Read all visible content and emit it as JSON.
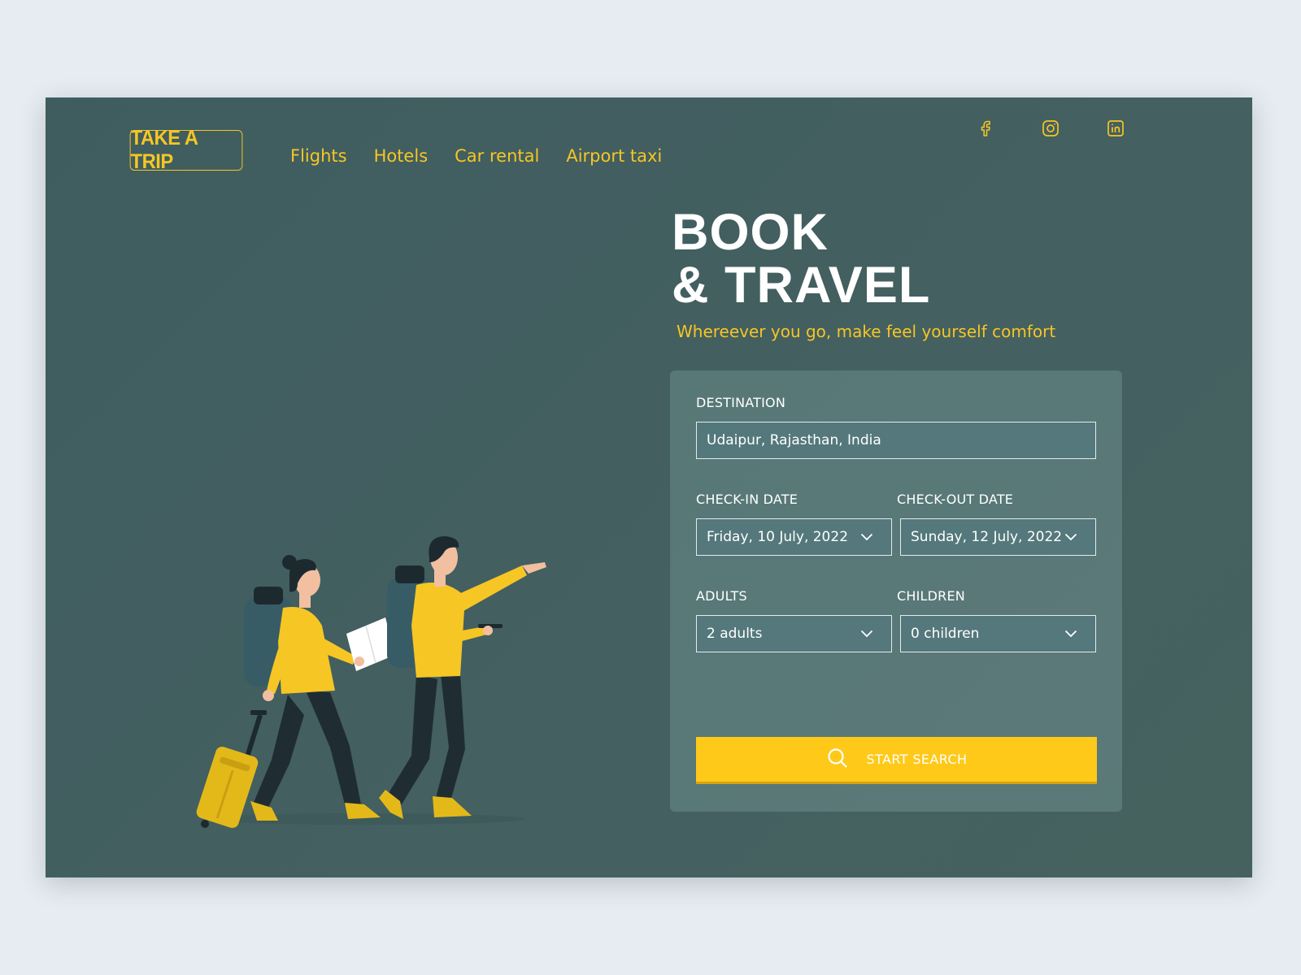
{
  "brand": {
    "logo_text": "TAKE A TRIP"
  },
  "nav": {
    "items": [
      {
        "label": "Flights"
      },
      {
        "label": "Hotels"
      },
      {
        "label": "Car rental"
      },
      {
        "label": "Airport taxi"
      }
    ]
  },
  "social": [
    {
      "icon": "facebook-icon"
    },
    {
      "icon": "instagram-icon"
    },
    {
      "icon": "linkedin-icon"
    }
  ],
  "hero": {
    "title_line1": "BOOK",
    "title_line2": "& TRAVEL",
    "subtitle": "Whereever you go, make feel yourself comfort"
  },
  "form": {
    "destination": {
      "label": "DESTINATION",
      "value": "Udaipur, Rajasthan, India"
    },
    "check_in": {
      "label": "CHECK-IN DATE",
      "value": "Friday, 10 July, 2022"
    },
    "check_out": {
      "label": "CHECK-OUT DATE",
      "value": "Sunday, 12 July, 2022"
    },
    "adults": {
      "label": "ADULTS",
      "value": "2 adults"
    },
    "children": {
      "label": "CHILDREN",
      "value": "0 children"
    },
    "submit_label": "START SEARCH"
  },
  "colors": {
    "background": "#e6ecf2",
    "panel": "#435f60",
    "accent": "#f6c624",
    "button": "#ffc919"
  }
}
